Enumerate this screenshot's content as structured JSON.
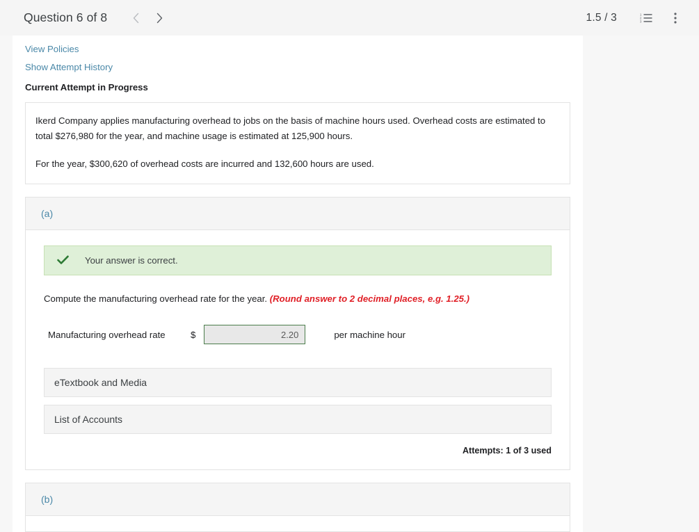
{
  "header": {
    "title": "Question 6 of 8",
    "prev_icon": "chevron-left-icon",
    "next_icon": "chevron-right-icon",
    "score": "1.5 / 3",
    "list_icon": "numbered-list-icon",
    "menu_icon": "kebab-menu-icon"
  },
  "links": {
    "view_policies": "View Policies",
    "show_attempt_history": "Show Attempt History",
    "attempt_status": "Current Attempt in Progress"
  },
  "problem": {
    "paragraph1": "Ikerd Company applies manufacturing overhead to jobs on the basis of machine hours used. Overhead costs are estimated to total $276,980 for the year, and machine usage is estimated at 125,900 hours.",
    "paragraph2": "For the year, $300,620 of overhead costs are incurred and 132,600 hours are used."
  },
  "part_a": {
    "label": "(a)",
    "banner": {
      "icon": "checkmark-icon",
      "text": "Your answer is correct."
    },
    "prompt_main": "Compute the manufacturing overhead rate for the year.",
    "prompt_hint": "(Round answer to 2 decimal places, e.g. 1.25.)",
    "answer_label": "Manufacturing overhead rate",
    "currency_symbol": "$",
    "answer_value": "2.20",
    "answer_placeholder": "",
    "answer_suffix": "per machine hour",
    "etextbook_button": "eTextbook and Media",
    "list_of_accounts_button": "List of Accounts",
    "attempts": "Attempts: 1 of 3 used"
  },
  "part_b": {
    "label": "(b)"
  },
  "colors": {
    "link": "#4a88a8",
    "success_bg": "#dff0d8",
    "success_fg": "#2d7a34",
    "hint_red": "#e01f26",
    "input_border": "#4a7c4a",
    "panel_bg": "#f4f4f4"
  }
}
